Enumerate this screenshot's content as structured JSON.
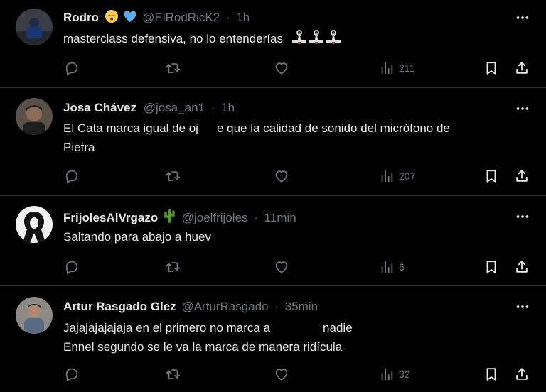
{
  "theme": {
    "background": "#000000",
    "divider": "#2f3336",
    "text": "#e7e9ea",
    "muted": "#71767b"
  },
  "tweets": [
    {
      "name": "Rodro",
      "emojis": [
        "sleeping-face-emoji",
        "blue-heart-emoji"
      ],
      "handle": "@ElRodRicK2",
      "time": "1h",
      "text": "masterclass defensiva, no lo entenderías",
      "trailing_emojis": [
        "cone-emoji",
        "cone-emoji",
        "cone-emoji"
      ],
      "views": "211"
    },
    {
      "name": "Josa Chávez",
      "handle": "@josa_an1",
      "time": "1h",
      "text_line1_a": "El Cata marca igual de oj",
      "text_line1_b": "e que la calidad de sonido del micrófono de",
      "text_line2": "Pietra",
      "views": "207"
    },
    {
      "name": "FrijolesAlVrgazo",
      "emojis": [
        "cactus-emoji"
      ],
      "handle": "@joelfrijoles",
      "time": "11min",
      "text": "Saltando para abajo a huev",
      "views": "6"
    },
    {
      "name": "Artur Rasgado Glez",
      "handle": "@ArturRasgado",
      "time": "35min",
      "text_line1_a": "Jajajajajajaja en el primero no marca a",
      "text_line1_b": "nadie",
      "text_line2": "Ennel segundo se le va la marca de manera ridícula",
      "views": "32"
    }
  ],
  "separator": "·",
  "icons": [
    "reply-icon",
    "retweet-icon",
    "like-icon",
    "views-icon",
    "bookmark-icon",
    "share-icon",
    "more-icon"
  ]
}
